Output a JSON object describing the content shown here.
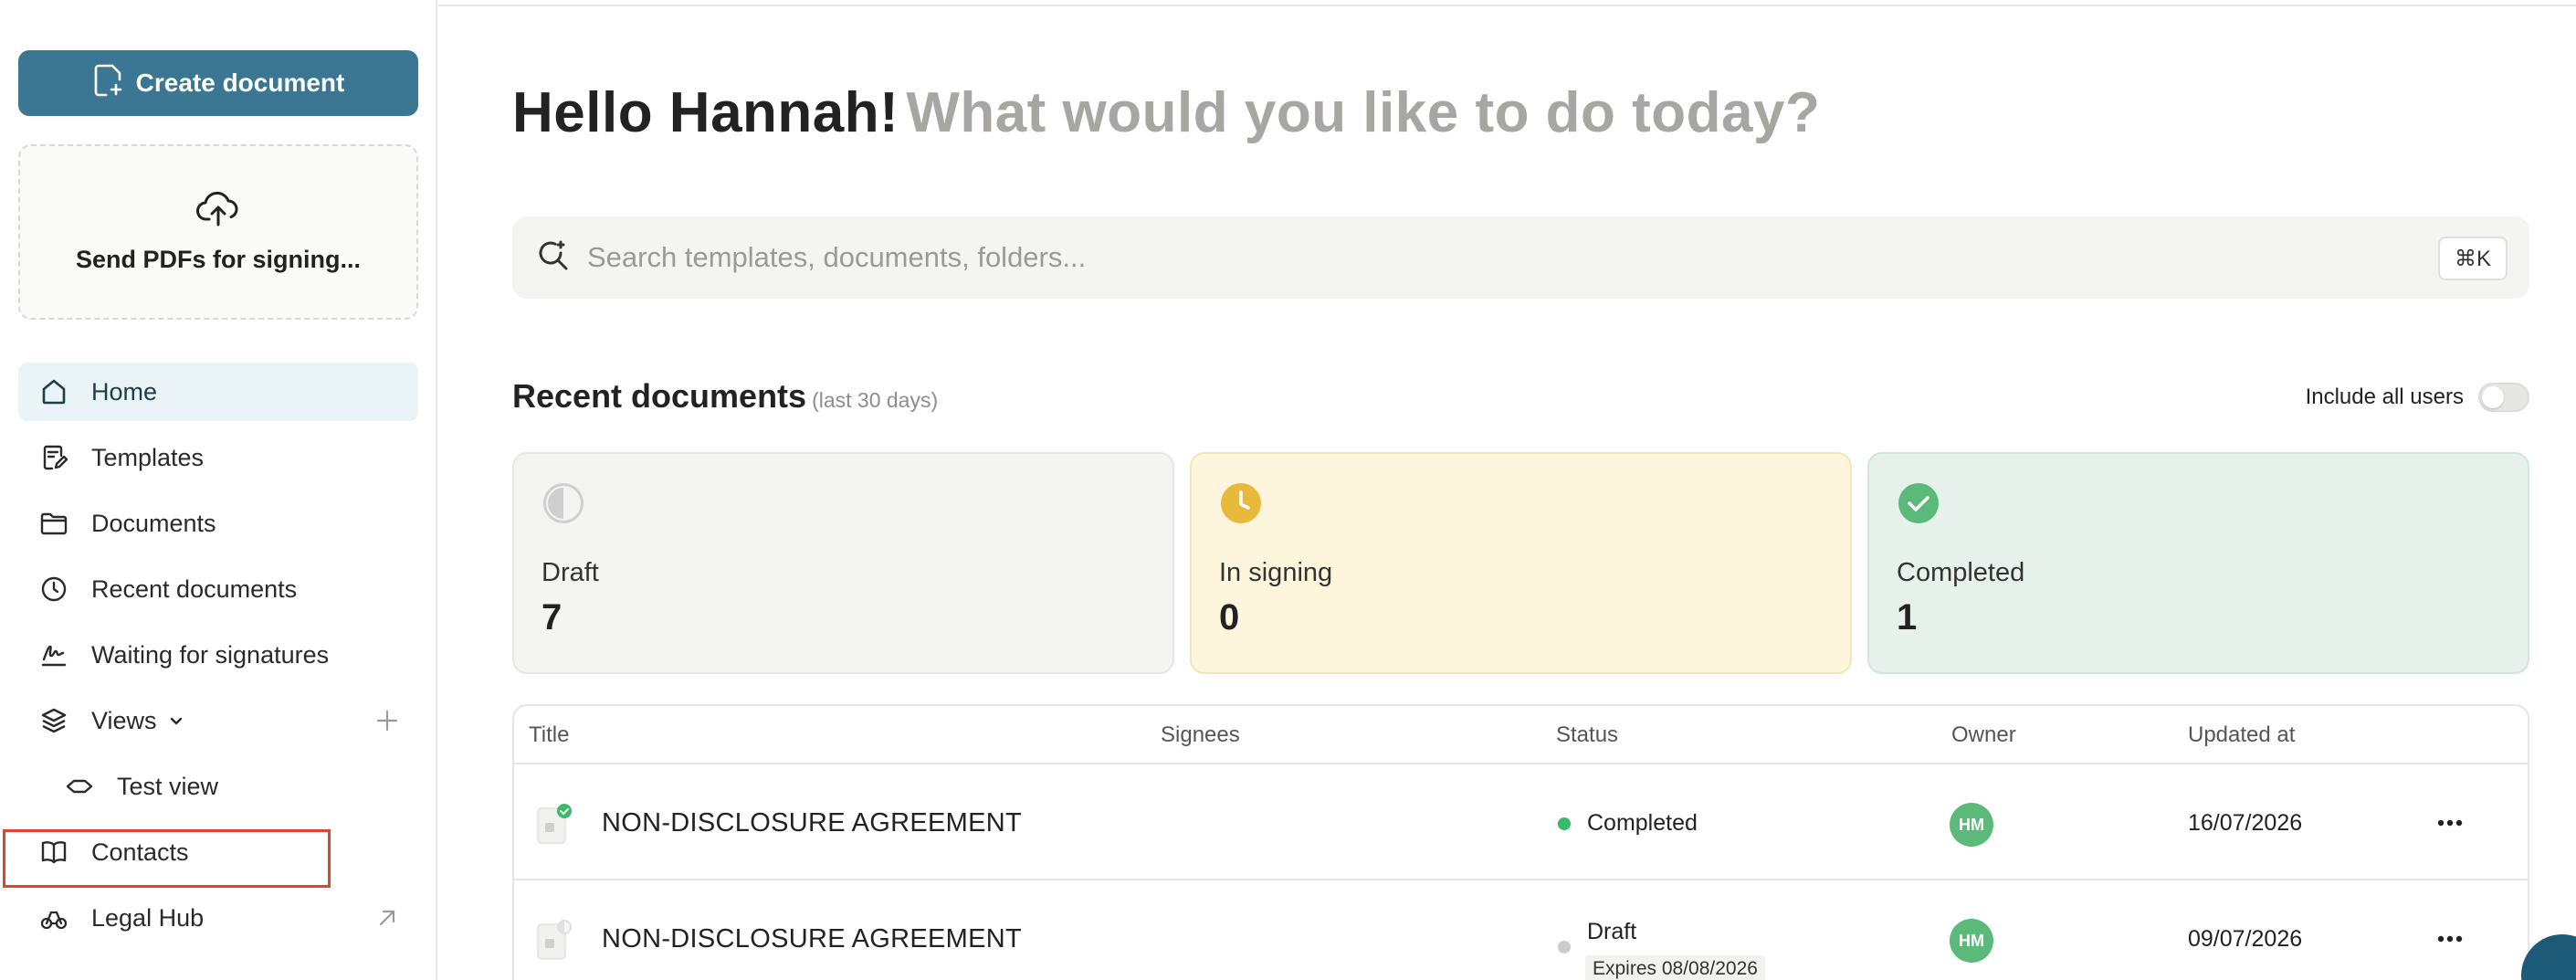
{
  "sidebar": {
    "create_button": "Create document",
    "upload_label": "Send PDFs for signing...",
    "items": [
      {
        "label": "Home",
        "icon": "home-icon"
      },
      {
        "label": "Templates",
        "icon": "template-icon"
      },
      {
        "label": "Documents",
        "icon": "folder-icon"
      },
      {
        "label": "Recent documents",
        "icon": "clock-icon"
      },
      {
        "label": "Waiting for signatures",
        "icon": "signature-icon"
      },
      {
        "label": "Views",
        "icon": "layers-icon"
      },
      {
        "label": "Test view",
        "icon": "diamond-icon"
      },
      {
        "label": "Contacts",
        "icon": "book-icon"
      },
      {
        "label": "Legal Hub",
        "icon": "scales-icon"
      }
    ]
  },
  "main": {
    "greeting_name": "Hello Hannah!",
    "greeting_question": "What would you like to do today?",
    "search": {
      "placeholder": "Search templates, documents, folders...",
      "shortcut": "⌘K"
    },
    "recent": {
      "title": "Recent documents",
      "subtitle": "(last 30 days)",
      "include_users_label": "Include all users"
    },
    "cards": [
      {
        "label": "Draft",
        "count": "7",
        "color": "#c9c9c9"
      },
      {
        "label": "In signing",
        "count": "0",
        "color": "#e8b93a"
      },
      {
        "label": "Completed",
        "count": "1",
        "color": "#5bb979"
      }
    ],
    "table": {
      "columns": [
        "Title",
        "Signees",
        "Status",
        "Owner",
        "Updated at"
      ],
      "rows": [
        {
          "title": "NON-DISCLOSURE AGREEMENT",
          "signees": "",
          "status": "Completed",
          "status_color": "#3cb86a",
          "expires": "",
          "owner": "HM",
          "updated": "16/07/2026"
        },
        {
          "title": "NON-DISCLOSURE AGREEMENT",
          "signees": "",
          "status": "Draft",
          "status_color": "#cccccc",
          "expires": "Expires 08/08/2026",
          "owner": "HM",
          "updated": "09/07/2026"
        }
      ]
    }
  }
}
